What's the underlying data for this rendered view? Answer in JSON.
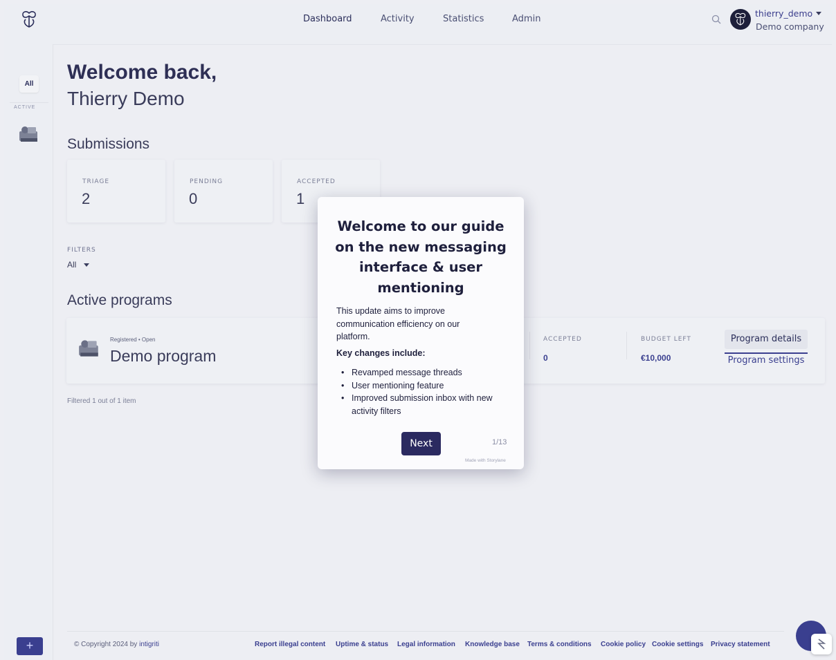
{
  "header": {
    "nav": [
      "Dashboard",
      "Activity",
      "Statistics",
      "Admin"
    ],
    "active_nav": "Dashboard",
    "user": {
      "username": "thierry_demo",
      "company": "Demo company"
    }
  },
  "sidebar": {
    "all_label": "All",
    "active_label": "ACTIVE",
    "add_label": "+"
  },
  "welcome": {
    "line1": "Welcome back,",
    "line2": "Thierry Demo"
  },
  "submissions": {
    "title": "Submissions",
    "stats": [
      {
        "label": "TRIAGE",
        "value": "2"
      },
      {
        "label": "PENDING",
        "value": "0"
      },
      {
        "label": "ACCEPTED",
        "value": "1"
      }
    ]
  },
  "filters": {
    "label": "FILTERS",
    "value": "All"
  },
  "programs": {
    "title": "Active programs",
    "items": [
      {
        "status": "Registered • Open",
        "name": "Demo program",
        "accepted_label": "ACCEPTED",
        "accepted_value": "0",
        "budget_label": "BUDGET LEFT",
        "budget_value": "€10,000",
        "details_button": "Program details",
        "settings_link": "Program settings"
      }
    ],
    "filtered_text": "Filtered 1 out of 1 item"
  },
  "footer": {
    "copyright_prefix": "© Copyright 2024 by ",
    "copyright_brand": "intigriti",
    "links": [
      "Report illegal content",
      "Uptime & status",
      "Legal information",
      "Knowledge base",
      "Terms & conditions",
      "Cookie policy",
      "Cookie settings",
      "Privacy statement"
    ]
  },
  "modal": {
    "title": "Welcome to our guide on the new messaging interface & user mentioning",
    "body": "This update aims to improve communication efficiency on our platform.",
    "key_heading": "Key changes include:",
    "bullets": [
      "Revamped message threads",
      "User mentioning feature",
      "Improved submission inbox with new activity filters"
    ],
    "next_label": "Next",
    "step": "1/13",
    "made_with": "Made with Storylane"
  },
  "colors": {
    "brand": "#3a3f8f",
    "modal_button": "#2b2a60",
    "background": "#edeef3"
  }
}
